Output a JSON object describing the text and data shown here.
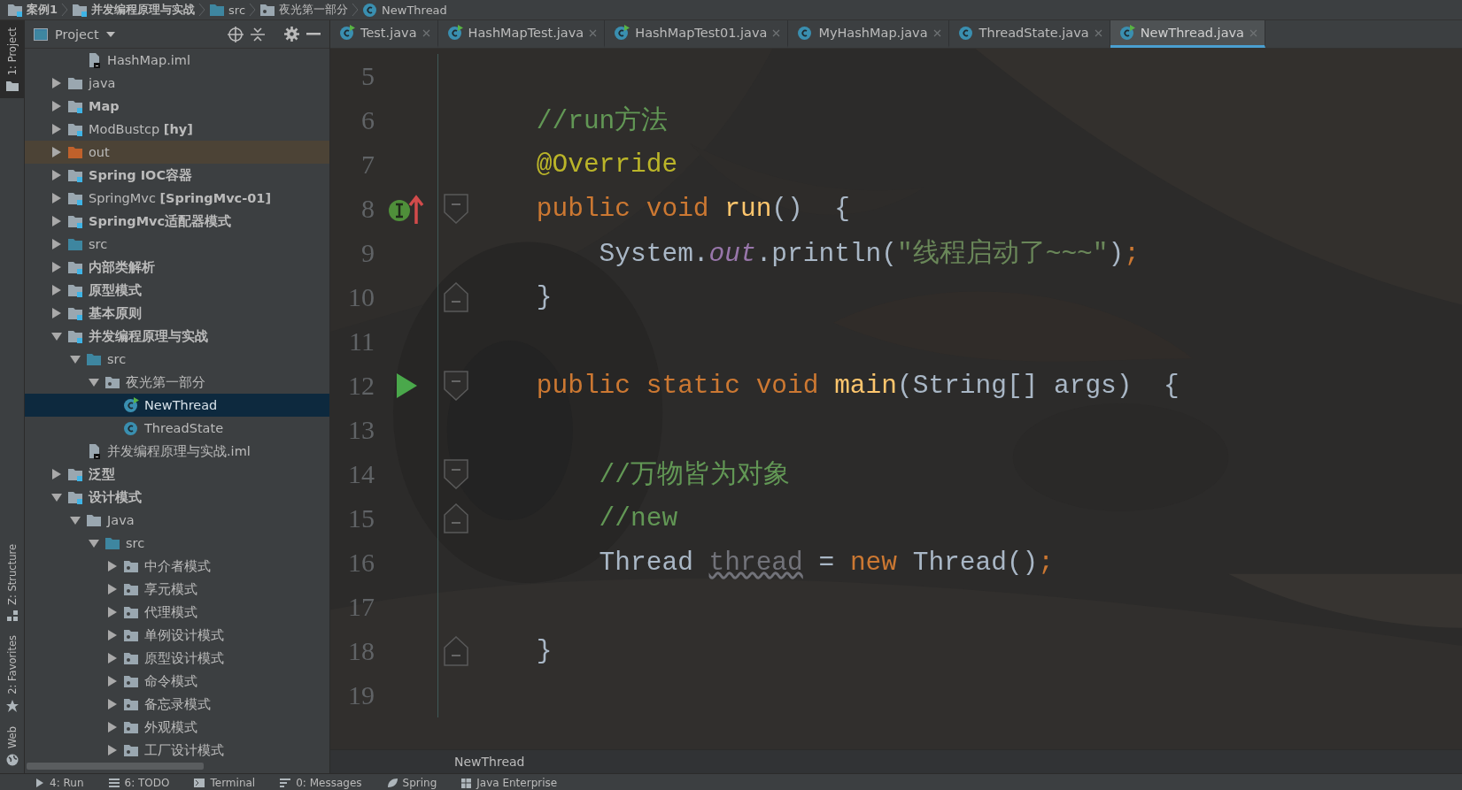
{
  "breadcrumb": [
    {
      "label": "案例1",
      "kind": "module",
      "bold": true
    },
    {
      "label": "并发编程原理与实战",
      "kind": "module",
      "bold": true
    },
    {
      "label": "src",
      "kind": "source",
      "bold": false
    },
    {
      "label": "夜光第一部分",
      "kind": "package",
      "bold": false
    },
    {
      "label": "NewThread",
      "kind": "class",
      "bold": false
    }
  ],
  "project_panel": {
    "title": "Project"
  },
  "tool_stripe": [
    {
      "label": "1: Project",
      "kind": "folder",
      "selected": true
    },
    {
      "label": "Z: Structure",
      "kind": "structure",
      "selected": false
    },
    {
      "label": "2: Favorites",
      "kind": "star",
      "selected": false
    },
    {
      "label": "Web",
      "kind": "globe",
      "selected": false
    }
  ],
  "tree": {
    "clipped_parent_children": [
      {
        "label": "HashMap.iml",
        "kind": "file",
        "bold": false,
        "selected": false
      }
    ],
    "items": [
      {
        "label": "java",
        "kind": "folder",
        "bold": false,
        "expanded": false,
        "selected": false
      },
      {
        "label": "Map",
        "kind": "module",
        "bold": true,
        "expanded": false,
        "selected": false
      },
      {
        "label": "ModBustcp **[hy]**",
        "kind": "module",
        "bold": false,
        "expanded": false,
        "selected": false
      },
      {
        "label": "out",
        "kind": "excluded",
        "bold": false,
        "expanded": false,
        "selected": false
      },
      {
        "label": "Spring IOC容器",
        "kind": "module",
        "bold": true,
        "expanded": false,
        "selected": false
      },
      {
        "label": "SpringMvc **[SpringMvc-01]**",
        "kind": "module",
        "bold": false,
        "expanded": false,
        "selected": false
      },
      {
        "label": "SpringMvc适配器模式",
        "kind": "module",
        "bold": true,
        "expanded": false,
        "selected": false
      },
      {
        "label": "src",
        "kind": "source",
        "bold": false,
        "expanded": false,
        "selected": false
      },
      {
        "label": "内部类解析",
        "kind": "module",
        "bold": true,
        "expanded": false,
        "selected": false
      },
      {
        "label": "原型模式",
        "kind": "module",
        "bold": true,
        "expanded": false,
        "selected": false
      },
      {
        "label": "基本原则",
        "kind": "module",
        "bold": true,
        "expanded": false,
        "selected": false
      },
      {
        "label": "并发编程原理与实战",
        "kind": "module",
        "bold": true,
        "expanded": true,
        "selected": false,
        "children": [
          {
            "label": "src",
            "kind": "source",
            "bold": false,
            "expanded": true,
            "selected": false,
            "children": [
              {
                "label": "夜光第一部分",
                "kind": "package",
                "bold": false,
                "expanded": true,
                "selected": false,
                "children": [
                  {
                    "label": "NewThread",
                    "kind": "class",
                    "runnable": true,
                    "bold": false,
                    "selected": true
                  },
                  {
                    "label": "ThreadState",
                    "kind": "class",
                    "runnable": false,
                    "bold": false,
                    "selected": false
                  }
                ]
              }
            ]
          },
          {
            "label": "并发编程原理与实战.iml",
            "kind": "file",
            "bold": false,
            "selected": false
          }
        ]
      },
      {
        "label": "泛型",
        "kind": "module",
        "bold": true,
        "expanded": false,
        "selected": false
      },
      {
        "label": "设计模式",
        "kind": "module",
        "bold": true,
        "expanded": true,
        "selected": false,
        "children": [
          {
            "label": "Java",
            "kind": "folder",
            "bold": false,
            "expanded": true,
            "selected": false,
            "children": [
              {
                "label": "src",
                "kind": "source",
                "bold": false,
                "expanded": true,
                "selected": false,
                "children": [
                  {
                    "label": "中介者模式",
                    "kind": "package",
                    "bold": false,
                    "expanded": false,
                    "selected": false
                  },
                  {
                    "label": "享元模式",
                    "kind": "package",
                    "bold": false,
                    "expanded": false,
                    "selected": false
                  },
                  {
                    "label": "代理模式",
                    "kind": "package",
                    "bold": false,
                    "expanded": false,
                    "selected": false
                  },
                  {
                    "label": "单例设计模式",
                    "kind": "package",
                    "bold": false,
                    "expanded": false,
                    "selected": false
                  },
                  {
                    "label": "原型设计模式",
                    "kind": "package",
                    "bold": false,
                    "expanded": false,
                    "selected": false
                  },
                  {
                    "label": "命令模式",
                    "kind": "package",
                    "bold": false,
                    "expanded": false,
                    "selected": false
                  },
                  {
                    "label": "备忘录模式",
                    "kind": "package",
                    "bold": false,
                    "expanded": false,
                    "selected": false
                  },
                  {
                    "label": "外观模式",
                    "kind": "package",
                    "bold": false,
                    "expanded": false,
                    "selected": false
                  },
                  {
                    "label": "工厂设计模式",
                    "kind": "package",
                    "bold": false,
                    "expanded": false,
                    "selected": false
                  }
                ]
              }
            ]
          }
        ]
      }
    ]
  },
  "tabs": [
    {
      "label": "Test.java",
      "runnable": true,
      "selected": false
    },
    {
      "label": "HashMapTest.java",
      "runnable": true,
      "selected": false
    },
    {
      "label": "HashMapTest01.java",
      "runnable": true,
      "selected": false
    },
    {
      "label": "MyHashMap.java",
      "runnable": false,
      "selected": false
    },
    {
      "label": "ThreadState.java",
      "runnable": false,
      "selected": false
    },
    {
      "label": "NewThread.java",
      "runnable": true,
      "selected": true
    }
  ],
  "editor": {
    "lines": [
      {
        "number": "5"
      },
      {
        "number": "6",
        "tokens": [
          {
            "kind": "comment",
            "text": "    //run方法"
          }
        ]
      },
      {
        "number": "7",
        "tokens": [
          {
            "kind": "annotation",
            "text": "    @Override"
          }
        ]
      },
      {
        "number": "8",
        "marker": {
          "kind": "implements"
        },
        "fold": {
          "kind": "start"
        },
        "tokens": [
          {
            "kind": "keyword",
            "text": "    public void "
          },
          {
            "kind": "method",
            "text": "run"
          },
          {
            "kind": "plain",
            "text": "()  {"
          }
        ]
      },
      {
        "number": "9",
        "tokens": [
          {
            "kind": "plain",
            "text": "        System."
          },
          {
            "kind": "static_field",
            "text": "out"
          },
          {
            "kind": "plain",
            "text": ".println("
          },
          {
            "kind": "string",
            "text": "\"线程启动了~~~\""
          },
          {
            "kind": "plain",
            "text": ")"
          },
          {
            "kind": "punct",
            "text": ";"
          }
        ]
      },
      {
        "number": "10",
        "fold": {
          "kind": "end"
        },
        "tokens": [
          {
            "kind": "plain",
            "text": "    }"
          }
        ]
      },
      {
        "number": "11"
      },
      {
        "number": "12",
        "marker": {
          "kind": "run"
        },
        "fold": {
          "kind": "start"
        },
        "tokens": [
          {
            "kind": "keyword",
            "text": "    public static void "
          },
          {
            "kind": "method",
            "text": "main"
          },
          {
            "kind": "plain",
            "text": "(String[] args)  {"
          }
        ]
      },
      {
        "number": "13"
      },
      {
        "number": "14",
        "fold": {
          "kind": "start"
        },
        "tokens": [
          {
            "kind": "comment",
            "text": "        //万物皆为对象"
          }
        ]
      },
      {
        "number": "15",
        "fold": {
          "kind": "end"
        },
        "tokens": [
          {
            "kind": "comment",
            "text": "        //new"
          }
        ]
      },
      {
        "number": "16",
        "tokens": [
          {
            "kind": "plain",
            "text": "        Thread "
          },
          {
            "kind": "unused",
            "text": "thread"
          },
          {
            "kind": "plain",
            "text": " = "
          },
          {
            "kind": "keyword",
            "text": "new"
          },
          {
            "kind": "plain",
            "text": " Thread()"
          },
          {
            "kind": "punct",
            "text": ";"
          }
        ]
      },
      {
        "number": "17"
      },
      {
        "number": "18",
        "fold": {
          "kind": "end"
        },
        "tokens": [
          {
            "kind": "plain",
            "text": "    }"
          }
        ]
      },
      {
        "number": "19"
      }
    ],
    "breadcrumb": "NewThread"
  },
  "bottom_tools": [
    {
      "label": "4: Run",
      "kind": "run"
    },
    {
      "label": "6: TODO",
      "kind": "list"
    },
    {
      "label": "Terminal",
      "kind": "terminal"
    },
    {
      "label": "0: Messages",
      "kind": "messages"
    },
    {
      "label": "Spring",
      "kind": "leaf"
    },
    {
      "label": "Java Enterprise",
      "kind": "grid"
    }
  ]
}
